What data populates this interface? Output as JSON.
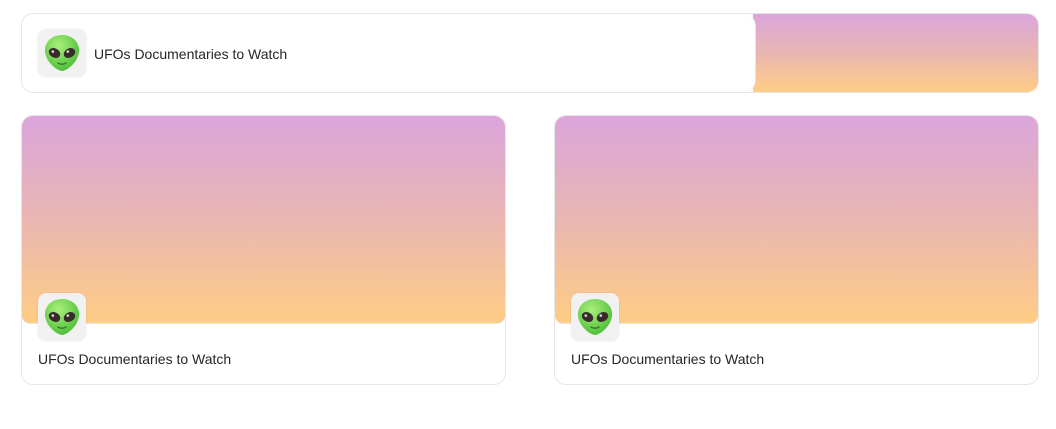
{
  "cards": [
    {
      "title": "UFOs Documentaries to Watch",
      "icon": "alien-icon"
    },
    {
      "title": "UFOs Documentaries to Watch",
      "icon": "alien-icon"
    },
    {
      "title": "UFOs Documentaries to Watch",
      "icon": "alien-icon"
    }
  ],
  "colors": {
    "gradient_top": "#dba5dc",
    "gradient_bottom": "#ffcd85",
    "alien_green": "#79d95c",
    "border": "#e6e6e6"
  }
}
